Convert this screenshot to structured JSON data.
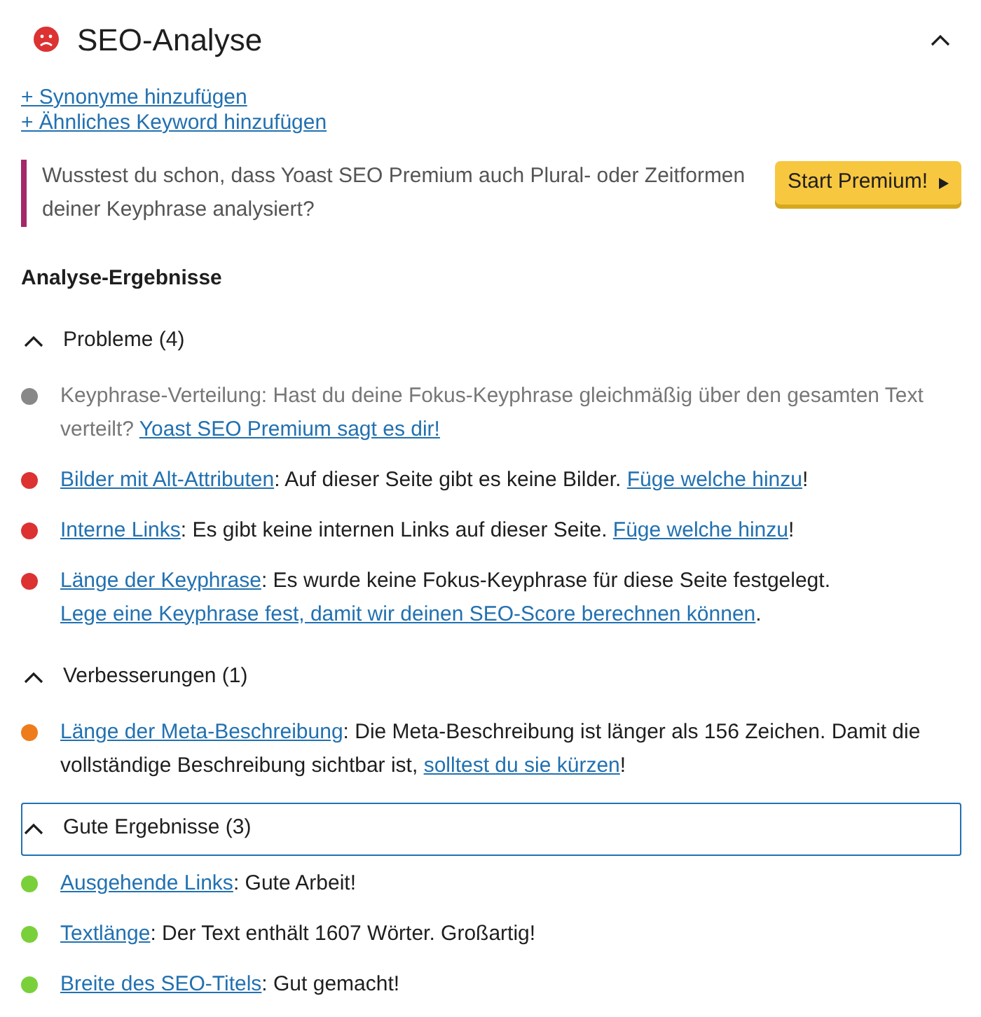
{
  "panel": {
    "title": "SEO-Analyse",
    "expanded": true
  },
  "links": [
    "+ Synonyme hinzufügen",
    "+ Ähnliches Keyword hinzufügen"
  ],
  "notice": {
    "text": "Wusstest du schon, dass Yoast SEO Premium auch Plural- oder Zeitformen deiner Keyphrase analysiert?",
    "button": "Start Premium!"
  },
  "results_heading": "Analyse-Ergebnisse",
  "sections": [
    {
      "title": "Probleme (4)",
      "expanded": true,
      "focused": false,
      "items": [
        {
          "color": "#888888",
          "muted": true,
          "parts": [
            {
              "kind": "text",
              "text": "Keyphrase-Verteilung: Hast du deine Fokus-Keyphrase gleichmäßig über den gesamten Text verteilt? "
            },
            {
              "kind": "link",
              "text": "Yoast SEO Premium sagt es dir!"
            }
          ]
        },
        {
          "color": "#dc3232",
          "muted": false,
          "parts": [
            {
              "kind": "link",
              "text": "Bilder mit Alt-Attributen"
            },
            {
              "kind": "text",
              "text": ": Auf dieser Seite gibt es keine Bilder. "
            },
            {
              "kind": "link",
              "text": "Füge welche hinzu"
            },
            {
              "kind": "text",
              "text": "!"
            }
          ]
        },
        {
          "color": "#dc3232",
          "muted": false,
          "parts": [
            {
              "kind": "link",
              "text": "Interne Links"
            },
            {
              "kind": "text",
              "text": ": Es gibt keine internen Links auf dieser Seite. "
            },
            {
              "kind": "link",
              "text": "Füge welche hinzu"
            },
            {
              "kind": "text",
              "text": "!"
            }
          ]
        },
        {
          "color": "#dc3232",
          "muted": false,
          "parts": [
            {
              "kind": "link",
              "text": "Länge der Keyphrase"
            },
            {
              "kind": "text",
              "text": ": Es wurde keine Fokus-Keyphrase für diese Seite festgelegt. "
            },
            {
              "kind": "link",
              "text": "Lege eine Keyphrase fest, damit wir deinen SEO-Score berechnen können"
            },
            {
              "kind": "text",
              "text": "."
            }
          ]
        }
      ]
    },
    {
      "title": "Verbesserungen (1)",
      "expanded": true,
      "focused": false,
      "items": [
        {
          "color": "#ee7c1b",
          "muted": false,
          "parts": [
            {
              "kind": "link",
              "text": "Länge der Meta-Beschreibung"
            },
            {
              "kind": "text",
              "text": ": Die Meta-Beschreibung ist länger als 156 Zeichen. Damit die vollständige Beschreibung sichtbar ist, "
            },
            {
              "kind": "link",
              "text": "solltest du sie kürzen"
            },
            {
              "kind": "text",
              "text": "!"
            }
          ]
        }
      ]
    },
    {
      "title": "Gute Ergebnisse (3)",
      "expanded": true,
      "focused": true,
      "items": [
        {
          "color": "#7ad03a",
          "muted": false,
          "parts": [
            {
              "kind": "link",
              "text": "Ausgehende Links"
            },
            {
              "kind": "text",
              "text": ": Gute Arbeit!"
            }
          ]
        },
        {
          "color": "#7ad03a",
          "muted": false,
          "parts": [
            {
              "kind": "link",
              "text": "Textlänge"
            },
            {
              "kind": "text",
              "text": ": Der Text enthält 1607 Wörter. Großartig!"
            }
          ]
        },
        {
          "color": "#7ad03a",
          "muted": false,
          "parts": [
            {
              "kind": "link",
              "text": "Breite des SEO-Titels"
            },
            {
              "kind": "text",
              "text": ": Gut gemacht!"
            }
          ]
        }
      ]
    }
  ]
}
